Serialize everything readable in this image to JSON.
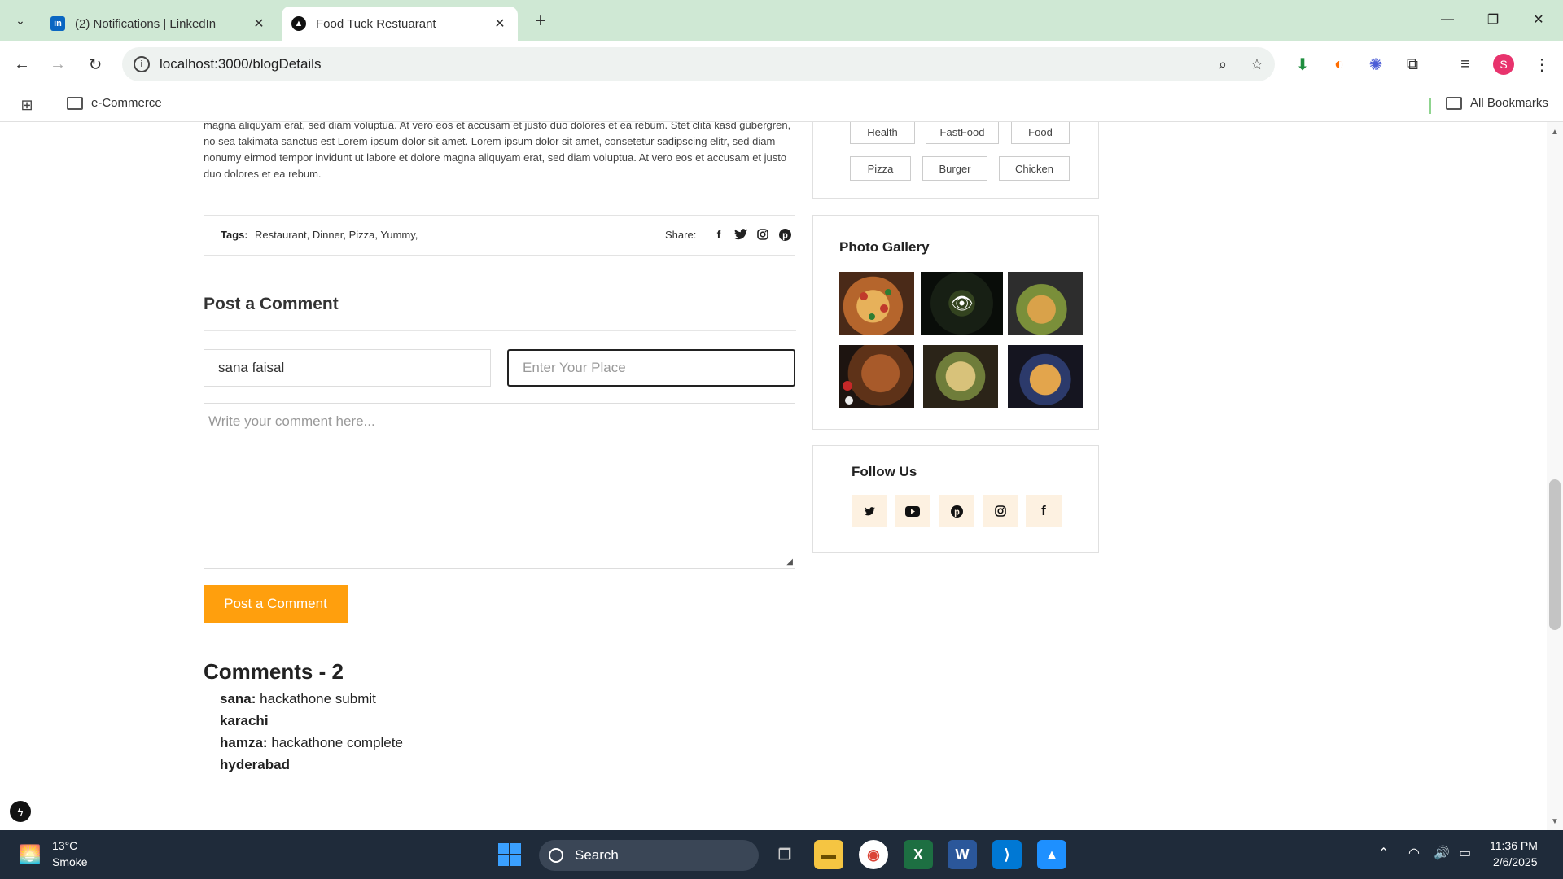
{
  "browser": {
    "tabs": [
      {
        "title": "(2) Notifications | LinkedIn",
        "favicon": "linkedin-icon"
      },
      {
        "title": "Food Tuck Restuarant",
        "favicon": "nextjs-icon"
      }
    ],
    "url": "localhost:3000/blogDetails",
    "bookmarks": {
      "folder": "e-Commerce",
      "all": "All Bookmarks"
    },
    "profile_initial": "S"
  },
  "article": {
    "paragraph": "magna aliquyam erat, sed diam voluptua. At vero eos et accusam et justo duo dolores et ea rebum. Stet clita kasd gubergren, no sea takimata sanctus est Lorem ipsum dolor sit amet. Lorem ipsum dolor sit amet, consetetur sadipscing elitr, sed diam nonumy eirmod tempor invidunt ut labore et dolore magna aliquyam erat, sed diam voluptua. At vero eos et accusam et justo duo dolores et ea rebum.",
    "tags_label": "Tags:",
    "tags_values": "Restaurant, Dinner, Pizza, Yummy,",
    "share_label": "Share:"
  },
  "post_comment": {
    "title": "Post a Comment",
    "name_value": "sana faisal",
    "place_placeholder": "Enter Your Place",
    "comment_placeholder": "Write your comment here...",
    "button": "Post a Comment"
  },
  "comments": {
    "title": "Comments - 2",
    "items": [
      {
        "name": "sana:",
        "text": "hackathone submit",
        "place": "karachi"
      },
      {
        "name": "hamza:",
        "text": "hackathone complete",
        "place": "hyderabad"
      }
    ]
  },
  "sidebar": {
    "tags": [
      "Health",
      "FastFood",
      "Food",
      "Pizza",
      "Burger",
      "Chicken"
    ],
    "gallery_title": "Photo Gallery",
    "follow_title": "Follow Us",
    "social_icons": [
      "twitter-icon",
      "youtube-icon",
      "pinterest-icon",
      "instagram-icon",
      "facebook-icon"
    ]
  },
  "taskbar": {
    "weather_temp": "13°C",
    "weather_cond": "Smoke",
    "search": "Search",
    "time": "11:36 PM",
    "date": "2/6/2025"
  },
  "colors": {
    "accent": "#ff9f0d",
    "tabbar": "#cfe8d4",
    "taskbar": "#1f2b3a"
  }
}
